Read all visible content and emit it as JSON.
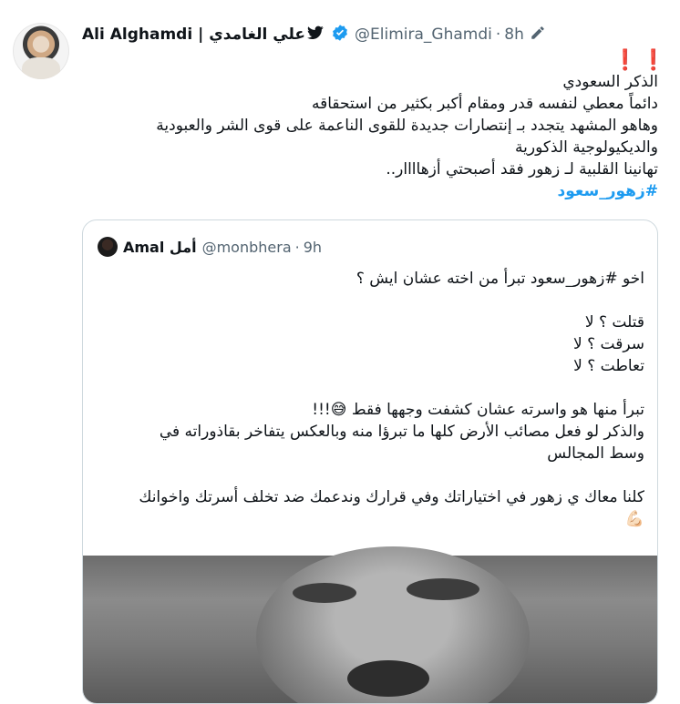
{
  "tweet": {
    "author_name": "Ali Alghamdi | علي الغامدي",
    "handle": "@Elimira_Ghamdi",
    "time": "8h",
    "separator": "·",
    "exclamation": "❗❗",
    "lines": [
      "الذكر السعودي",
      "دائماً معطي لنفسه قدر ومقام أكبر بكثير من استحقاقه",
      "وهاهو المشهد يتجدد بـ إنتصارات جديدة للقوى الناعمة على قوى الشر والعبودية",
      "والديكيولوجية الذكورية",
      "تهانينا القلبية لـ زهور فقد أصبحتي أزهاااار.."
    ],
    "hashtag": "#زهور_سعود"
  },
  "quote": {
    "author_name": "Amal أمل",
    "handle": "@monbhera",
    "time": "9h",
    "separator": "·",
    "lines": [
      "اخو #زهور_سعود تبرأ من اخته عشان ايش ؟",
      "",
      "قتلت ؟ لا",
      "سرقت ؟ لا",
      "تعاطت ؟ لا",
      "",
      "تبرأ منها هو واسرته عشان كشفت وجهها فقط 😅!!!",
      "والذكر لو فعل مصائب الأرض كلها ما تبرؤا منه وبالعكس يتفاخر بقاذوراته في",
      "وسط المجالس",
      "",
      "كلنا معاك ي زهور في اختياراتك وفي قرارك وندعمك ضد تخلف أسرتك واخوانك",
      "💪🏻"
    ]
  },
  "colors": {
    "link": "#1d9bf0",
    "secondary_text": "#536471",
    "border": "#cfd9de",
    "verified": "#1d9bf0"
  },
  "icons": [
    "twitter-bird-icon",
    "verified-badge-icon",
    "edit-pencil-icon"
  ]
}
